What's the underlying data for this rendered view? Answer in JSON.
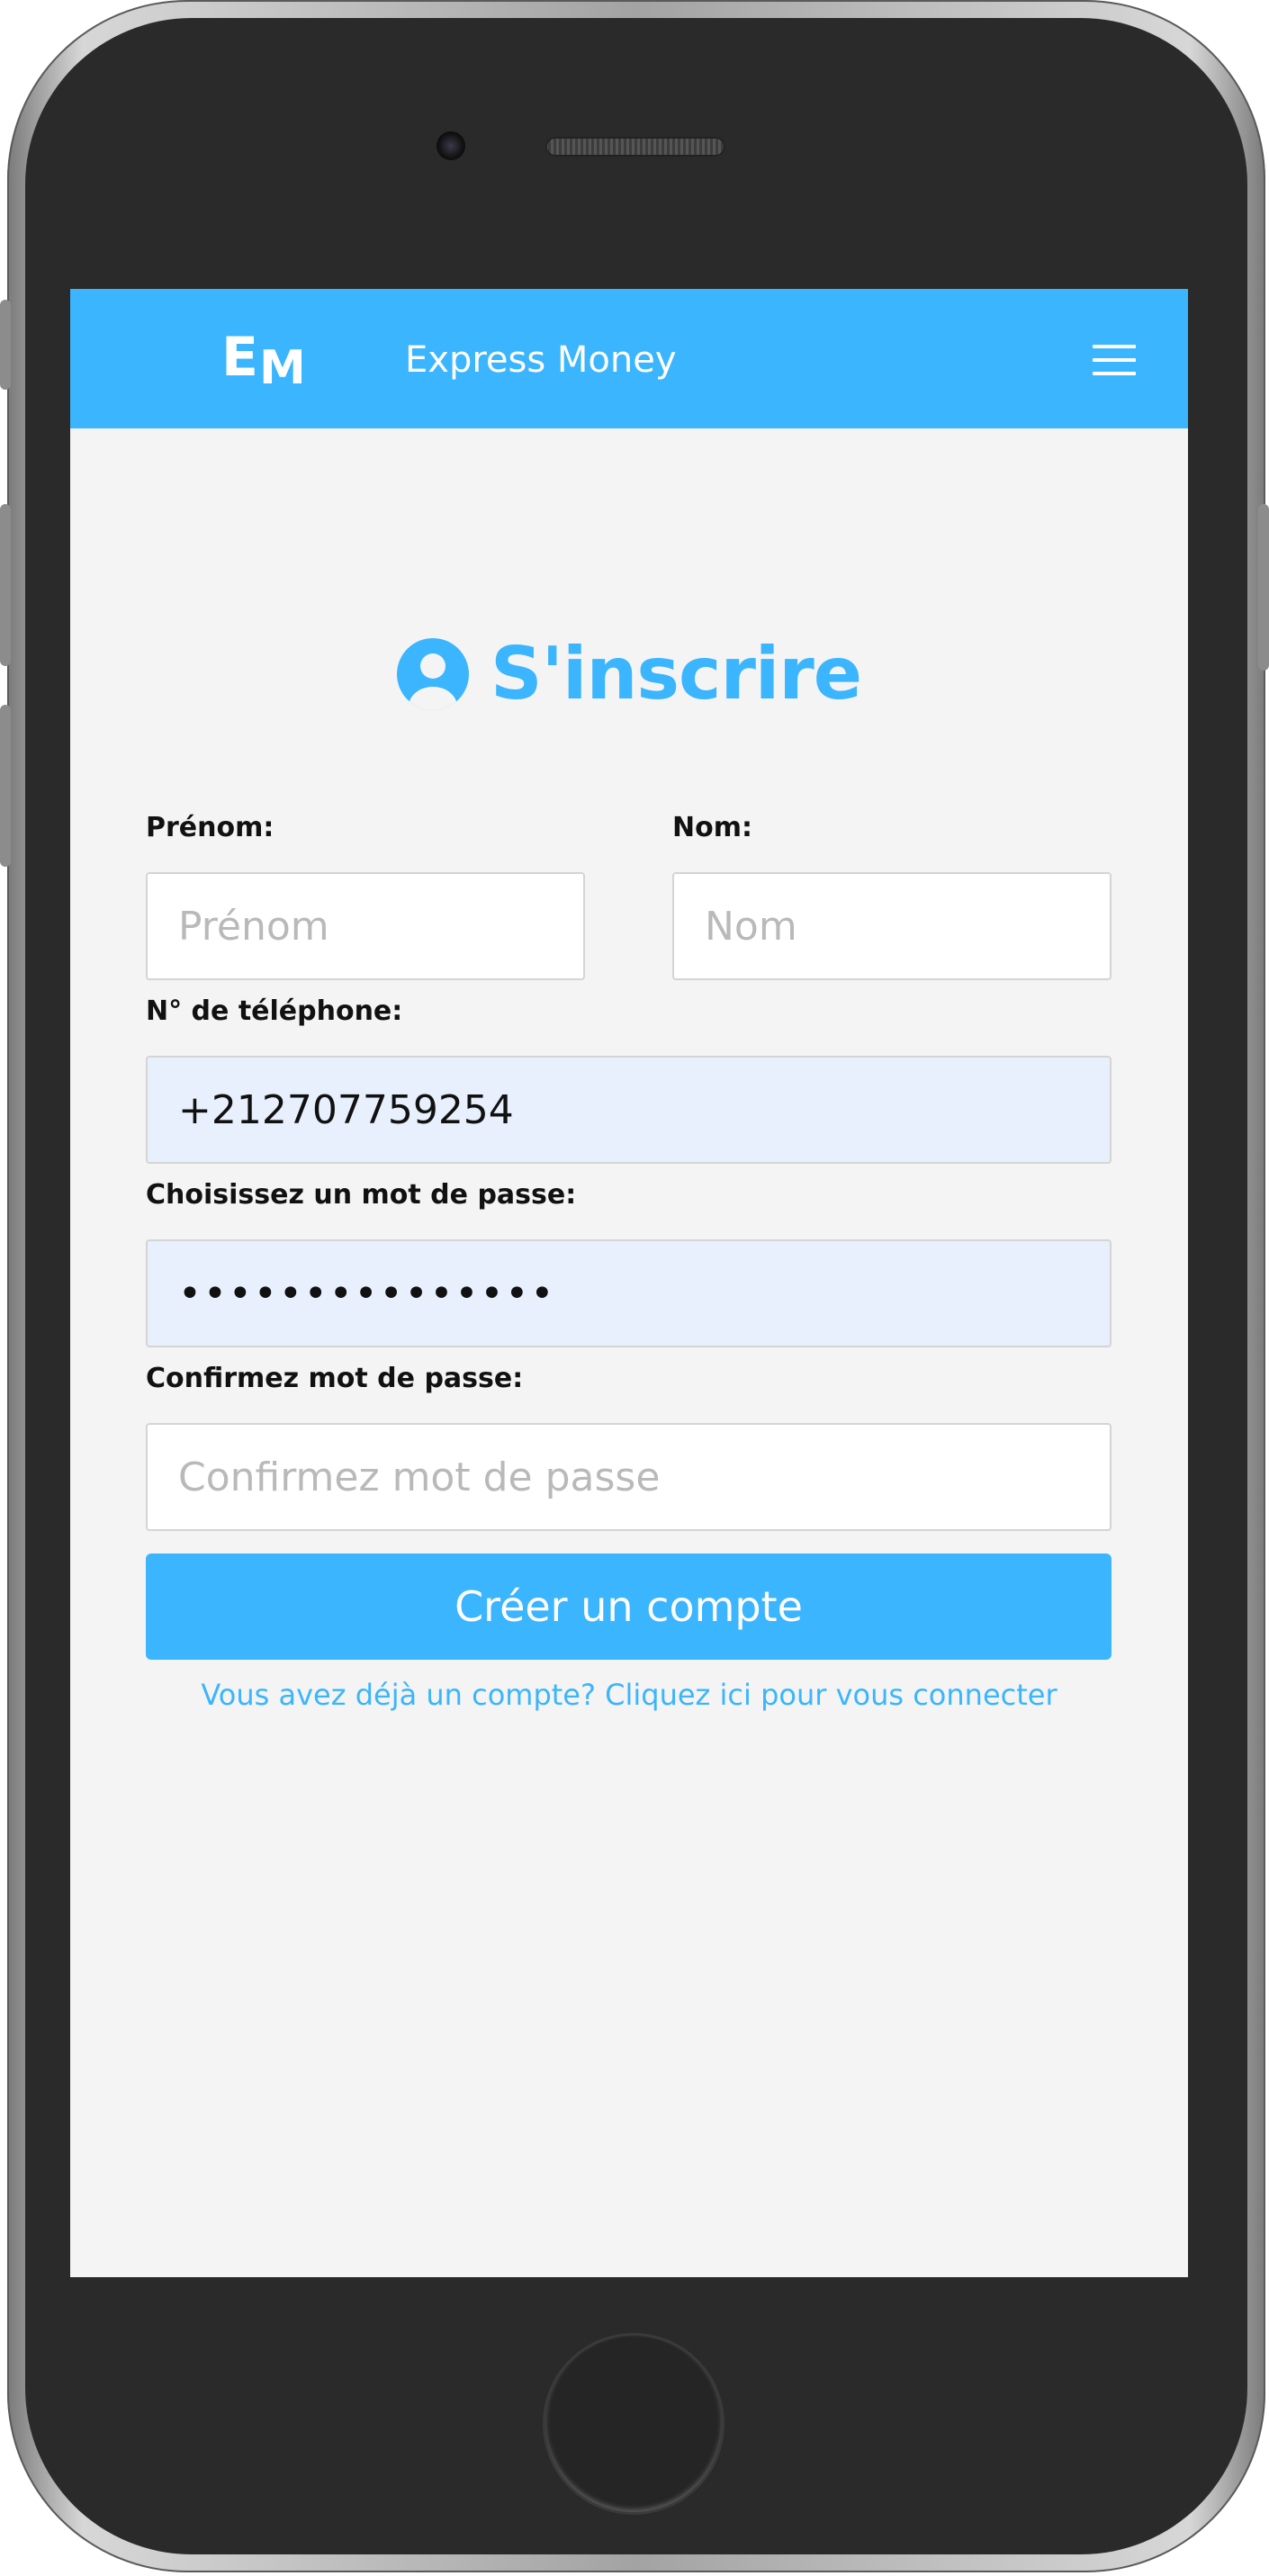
{
  "header": {
    "logo_e": "E",
    "logo_m": "M",
    "brand": "Express Money",
    "menu_icon": "hamburger-menu-icon"
  },
  "page": {
    "title": "S'inscrire",
    "title_icon": "user-circle-icon"
  },
  "form": {
    "first_name": {
      "label": "Prénom:",
      "placeholder": "Prénom",
      "value": ""
    },
    "last_name": {
      "label": "Nom:",
      "placeholder": "Nom",
      "value": ""
    },
    "phone": {
      "label": "N° de téléphone:",
      "value": "+212707759254"
    },
    "password": {
      "label": "Choisissez un mot de passe:",
      "masked_value": "•••••••••••••••"
    },
    "confirm_password": {
      "label": "Confirmez mot de passe:",
      "placeholder": "Confirmez mot de passe",
      "value": ""
    },
    "submit_label": "Créer un compte",
    "login_link": "Vous avez déjà un compte? Cliquez ici pour vous connecter"
  },
  "colors": {
    "accent": "#3bb5fd",
    "screen_background": "#f4f4f4",
    "autofill_background": "#e8f0fe",
    "phone_body": "#2a2a2b"
  }
}
